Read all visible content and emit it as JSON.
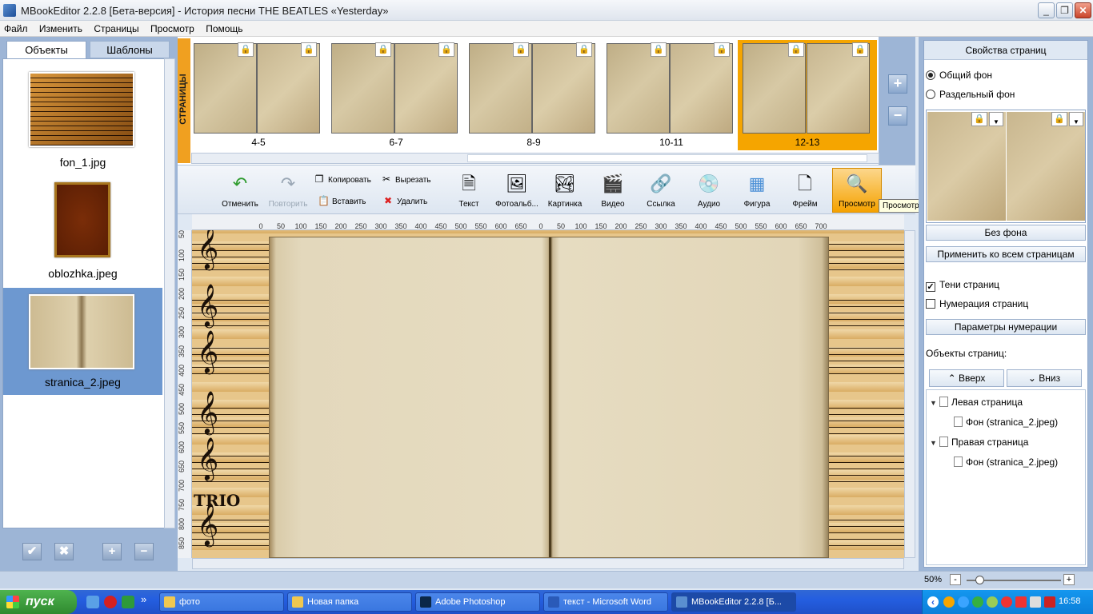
{
  "window": {
    "title": "MBookEditor 2.2.8 [Бета-версия] - История песни THE BEATLES «Yesterday»",
    "minimize": "_",
    "restore": "❐",
    "close": "✕"
  },
  "menu": [
    "Файл",
    "Изменить",
    "Страницы",
    "Просмотр",
    "Помощь"
  ],
  "left_panel": {
    "tabs": [
      "Объекты",
      "Шаблоны"
    ],
    "active_tab": "Объекты",
    "items": [
      {
        "name": "fon_1.jpg",
        "selected": false
      },
      {
        "name": "oblozhka.jpeg",
        "selected": false
      },
      {
        "name": "stranica_2.jpeg",
        "selected": true
      }
    ],
    "buttons": {
      "check": "✔",
      "cross": "✖",
      "add": "+",
      "remove": "−"
    }
  },
  "pages_strip": {
    "label": "СТРАНИЦЫ",
    "spreads": [
      {
        "label": "4-5",
        "selected": false
      },
      {
        "label": "6-7",
        "selected": false
      },
      {
        "label": "8-9",
        "selected": false
      },
      {
        "label": "10-11",
        "selected": false
      },
      {
        "label": "12-13",
        "selected": true
      }
    ],
    "zoom_in": "+",
    "zoom_out": "−"
  },
  "toolbar": {
    "undo": "Отменить",
    "redo": "Повторить",
    "copy": "Копировать",
    "paste": "Вставить",
    "cut": "Вырезать",
    "delete": "Удалить",
    "text": "Текст",
    "photoalbum": "Фотоальб...",
    "picture": "Картинка",
    "video": "Видео",
    "link": "Ссылка",
    "audio": "Аудио",
    "shape": "Фигура",
    "frame": "Фрейм",
    "preview": "Просмотр",
    "tooltip": "Просмотр"
  },
  "ruler": {
    "h_ticks": [
      "0",
      "50",
      "100",
      "150",
      "200",
      "250",
      "300",
      "350",
      "400",
      "450",
      "500",
      "550",
      "600",
      "650",
      "0",
      "50",
      "100",
      "150",
      "200",
      "250",
      "300",
      "350",
      "400",
      "450",
      "500",
      "550",
      "600",
      "650",
      "700"
    ],
    "v_ticks": [
      "50",
      "100",
      "150",
      "200",
      "250",
      "300",
      "350",
      "400",
      "450",
      "500",
      "550",
      "600",
      "650",
      "700",
      "750",
      "800",
      "850"
    ]
  },
  "canvas": {
    "trio_text": "TRIO"
  },
  "right_panel": {
    "header": "Свойства страниц",
    "bg_common": "Общий фон",
    "bg_separate": "Раздельный фон",
    "bg_common_selected": true,
    "no_background": "Без фона",
    "apply_all": "Применить ко всем страницам",
    "page_shadows": "Тени страниц",
    "page_shadows_checked": true,
    "page_numbering": "Нумерация страниц",
    "page_numbering_checked": false,
    "numbering_params": "Параметры нумерации",
    "objects_title": "Объекты страниц:",
    "up": "Вверх",
    "down": "Вниз",
    "tree": [
      {
        "label": "Левая страница",
        "children": [
          "Фон (stranica_2.jpeg)"
        ]
      },
      {
        "label": "Правая страница",
        "children": [
          "Фон (stranica_2.jpeg)"
        ]
      }
    ]
  },
  "statusbar": {
    "zoom": "50%",
    "zoom_minus": "-",
    "zoom_plus": "+",
    "zoom_level": 0.1
  },
  "taskbar": {
    "start": "пуск",
    "more": "»",
    "tasks": [
      {
        "label": "фото",
        "active": false
      },
      {
        "label": "Новая папка",
        "active": false
      },
      {
        "label": "Adobe Photoshop",
        "active": false
      },
      {
        "label": "текст - Microsoft Word",
        "active": false
      },
      {
        "label": "MBookEditor 2.2.8 [Б...",
        "active": true
      }
    ],
    "tray_arrow": "‹",
    "clock": "16:58"
  },
  "colors": {
    "accent_orange": "#f5a500",
    "panel_blue": "#9db5d6",
    "taskbar_blue": "#245ee0",
    "start_green": "#2f8a2f"
  }
}
